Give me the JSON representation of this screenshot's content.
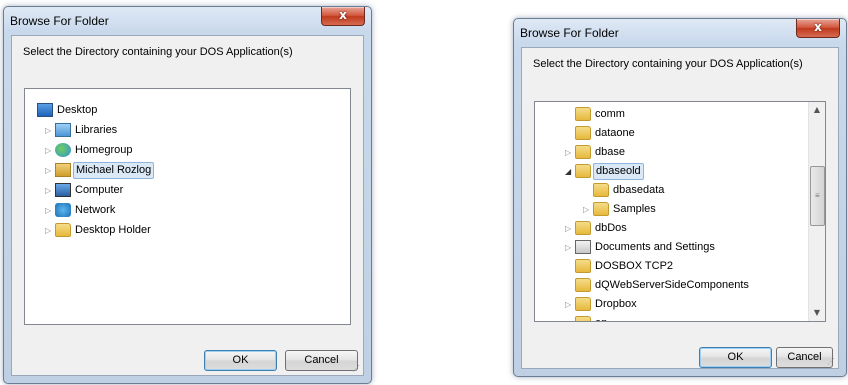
{
  "dialog1": {
    "title": "Browse For Folder",
    "close": "x",
    "prompt": "Select the Directory containing your DOS Application(s)",
    "ok": "OK",
    "cancel": "Cancel",
    "items": [
      {
        "label": "Desktop",
        "icon": "desktop-icon",
        "expander": ""
      },
      {
        "label": "Libraries",
        "icon": "libraries-icon",
        "expander": "▷"
      },
      {
        "label": "Homegroup",
        "icon": "homegroup-icon",
        "expander": "▷"
      },
      {
        "label": "Michael Rozlog",
        "icon": "user-folder-icon",
        "expander": "▷",
        "selected": true
      },
      {
        "label": "Computer",
        "icon": "computer-icon",
        "expander": "▷"
      },
      {
        "label": "Network",
        "icon": "network-icon",
        "expander": "▷"
      },
      {
        "label": "Desktop Holder",
        "icon": "folder-icon",
        "expander": "▷"
      }
    ]
  },
  "dialog2": {
    "title": "Browse For Folder",
    "close": "x",
    "prompt": "Select the Directory containing your DOS Application(s)",
    "ok": "OK",
    "cancel": "Cancel",
    "items": [
      {
        "label": "comm",
        "icon": "folder-icon",
        "expander": ""
      },
      {
        "label": "dataone",
        "icon": "folder-icon",
        "expander": ""
      },
      {
        "label": "dbase",
        "icon": "folder-icon",
        "expander": "▷"
      },
      {
        "label": "dbaseold",
        "icon": "folder-icon",
        "expander": "◢",
        "selected": true
      },
      {
        "label": "dbasedata",
        "icon": "folder-icon",
        "expander": ""
      },
      {
        "label": "Samples",
        "icon": "folder-icon",
        "expander": "▷"
      },
      {
        "label": "dbDos",
        "icon": "folder-icon",
        "expander": "▷"
      },
      {
        "label": "Documents and Settings",
        "icon": "shortcut-folder-icon",
        "expander": "▷"
      },
      {
        "label": "DOSBOX TCP2",
        "icon": "folder-icon",
        "expander": ""
      },
      {
        "label": "dQWebServerSideComponents",
        "icon": "folder-icon",
        "expander": ""
      },
      {
        "label": "Dropbox",
        "icon": "folder-icon",
        "expander": "▷"
      },
      {
        "label": "en",
        "icon": "folder-icon",
        "expander": "▷"
      }
    ],
    "scrollbar": {
      "up": "▲",
      "down": "▼",
      "grip": "≡"
    }
  }
}
